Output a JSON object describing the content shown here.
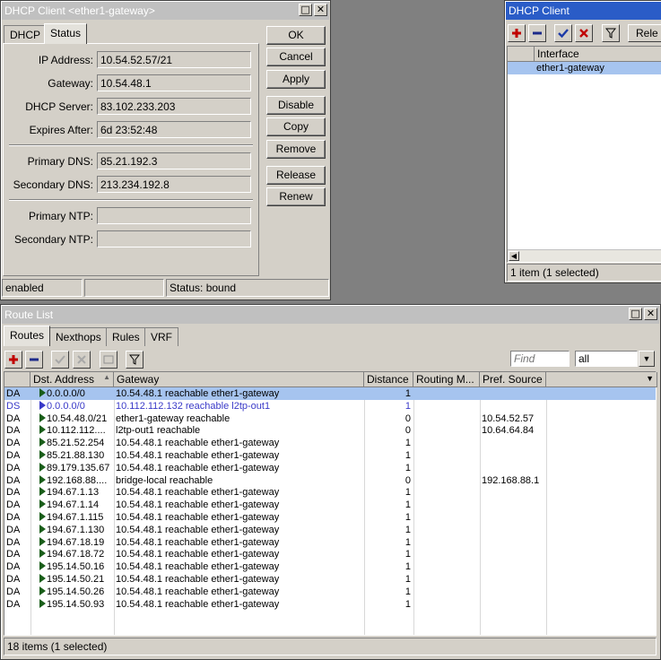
{
  "dhcp_window": {
    "title": "DHCP Client <ether1-gateway>",
    "tabs": [
      "DHCP",
      "Status"
    ],
    "fields": [
      {
        "label": "IP Address:",
        "value": "10.54.52.57/21"
      },
      {
        "label": "Gateway:",
        "value": "10.54.48.1"
      },
      {
        "label": "DHCP Server:",
        "value": "83.102.233.203"
      },
      {
        "label": "Expires After:",
        "value": "6d 23:52:48"
      },
      {
        "label": "Primary DNS:",
        "value": "85.21.192.3"
      },
      {
        "label": "Secondary DNS:",
        "value": "213.234.192.8"
      },
      {
        "label": "Primary NTP:",
        "value": ""
      },
      {
        "label": "Secondary NTP:",
        "value": ""
      }
    ],
    "buttons": [
      "OK",
      "Cancel",
      "Apply",
      "Disable",
      "Copy",
      "Remove",
      "Release",
      "Renew"
    ],
    "status": {
      "left": "enabled",
      "middle": "",
      "right": "Status: bound"
    }
  },
  "dhcp_list_window": {
    "title": "DHCP Client",
    "toolbar": {
      "partial_button": "Rele"
    },
    "column_interface": "Interface",
    "rows": [
      {
        "interface": "ether1-gateway"
      }
    ],
    "status": "1 item (1 selected)"
  },
  "route_window": {
    "title": "Route List",
    "tabs": [
      "Routes",
      "Nexthops",
      "Rules",
      "VRF"
    ],
    "find_placeholder": "Find",
    "filter_value": "all",
    "columns": [
      "",
      "Dst. Address",
      "Gateway",
      "Distance",
      "Routing M...",
      "Pref. Source"
    ],
    "rows": [
      {
        "flags": "DA",
        "dst": "0.0.0.0/0",
        "gateway": "10.54.48.1 reachable ether1-gateway",
        "distance": "1",
        "routing_mark": "",
        "pref_source": "",
        "selected": true,
        "style": "normal"
      },
      {
        "flags": "DS",
        "dst": "0.0.0.0/0",
        "gateway": "10.112.112.132 reachable l2tp-out1",
        "distance": "1",
        "routing_mark": "",
        "pref_source": "",
        "selected": false,
        "style": "ds"
      },
      {
        "flags": "DA",
        "dst": "10.54.48.0/21",
        "gateway": "ether1-gateway reachable",
        "distance": "0",
        "routing_mark": "",
        "pref_source": "10.54.52.57",
        "selected": false,
        "style": "normal"
      },
      {
        "flags": "DA",
        "dst": "10.112.112....",
        "gateway": "l2tp-out1 reachable",
        "distance": "0",
        "routing_mark": "",
        "pref_source": "10.64.64.84",
        "selected": false,
        "style": "normal"
      },
      {
        "flags": "DA",
        "dst": "85.21.52.254",
        "gateway": "10.54.48.1 reachable ether1-gateway",
        "distance": "1",
        "routing_mark": "",
        "pref_source": "",
        "selected": false,
        "style": "normal"
      },
      {
        "flags": "DA",
        "dst": "85.21.88.130",
        "gateway": "10.54.48.1 reachable ether1-gateway",
        "distance": "1",
        "routing_mark": "",
        "pref_source": "",
        "selected": false,
        "style": "normal"
      },
      {
        "flags": "DA",
        "dst": "89.179.135.67",
        "gateway": "10.54.48.1 reachable ether1-gateway",
        "distance": "1",
        "routing_mark": "",
        "pref_source": "",
        "selected": false,
        "style": "normal"
      },
      {
        "flags": "DA",
        "dst": "192.168.88....",
        "gateway": "bridge-local reachable",
        "distance": "0",
        "routing_mark": "",
        "pref_source": "192.168.88.1",
        "selected": false,
        "style": "normal"
      },
      {
        "flags": "DA",
        "dst": "194.67.1.13",
        "gateway": "10.54.48.1 reachable ether1-gateway",
        "distance": "1",
        "routing_mark": "",
        "pref_source": "",
        "selected": false,
        "style": "normal"
      },
      {
        "flags": "DA",
        "dst": "194.67.1.14",
        "gateway": "10.54.48.1 reachable ether1-gateway",
        "distance": "1",
        "routing_mark": "",
        "pref_source": "",
        "selected": false,
        "style": "normal"
      },
      {
        "flags": "DA",
        "dst": "194.67.1.115",
        "gateway": "10.54.48.1 reachable ether1-gateway",
        "distance": "1",
        "routing_mark": "",
        "pref_source": "",
        "selected": false,
        "style": "normal"
      },
      {
        "flags": "DA",
        "dst": "194.67.1.130",
        "gateway": "10.54.48.1 reachable ether1-gateway",
        "distance": "1",
        "routing_mark": "",
        "pref_source": "",
        "selected": false,
        "style": "normal"
      },
      {
        "flags": "DA",
        "dst": "194.67.18.19",
        "gateway": "10.54.48.1 reachable ether1-gateway",
        "distance": "1",
        "routing_mark": "",
        "pref_source": "",
        "selected": false,
        "style": "normal"
      },
      {
        "flags": "DA",
        "dst": "194.67.18.72",
        "gateway": "10.54.48.1 reachable ether1-gateway",
        "distance": "1",
        "routing_mark": "",
        "pref_source": "",
        "selected": false,
        "style": "normal"
      },
      {
        "flags": "DA",
        "dst": "195.14.50.16",
        "gateway": "10.54.48.1 reachable ether1-gateway",
        "distance": "1",
        "routing_mark": "",
        "pref_source": "",
        "selected": false,
        "style": "normal"
      },
      {
        "flags": "DA",
        "dst": "195.14.50.21",
        "gateway": "10.54.48.1 reachable ether1-gateway",
        "distance": "1",
        "routing_mark": "",
        "pref_source": "",
        "selected": false,
        "style": "normal"
      },
      {
        "flags": "DA",
        "dst": "195.14.50.26",
        "gateway": "10.54.48.1 reachable ether1-gateway",
        "distance": "1",
        "routing_mark": "",
        "pref_source": "",
        "selected": false,
        "style": "normal"
      },
      {
        "flags": "DA",
        "dst": "195.14.50.93",
        "gateway": "10.54.48.1 reachable ether1-gateway",
        "distance": "1",
        "routing_mark": "",
        "pref_source": "",
        "selected": false,
        "style": "normal"
      }
    ],
    "status": "18 items (1 selected)"
  },
  "icons": {
    "add": "plus-icon",
    "remove": "minus-icon",
    "enable": "check-icon",
    "disable": "cross-icon",
    "comment": "comment-icon",
    "filter": "filter-icon",
    "restore": "restore-icon",
    "close": "close-icon"
  },
  "colors": {
    "selection": "#a6c4ef",
    "dynamic_static_text": "#3a3ac8",
    "active_title": "#2a5cc7"
  }
}
